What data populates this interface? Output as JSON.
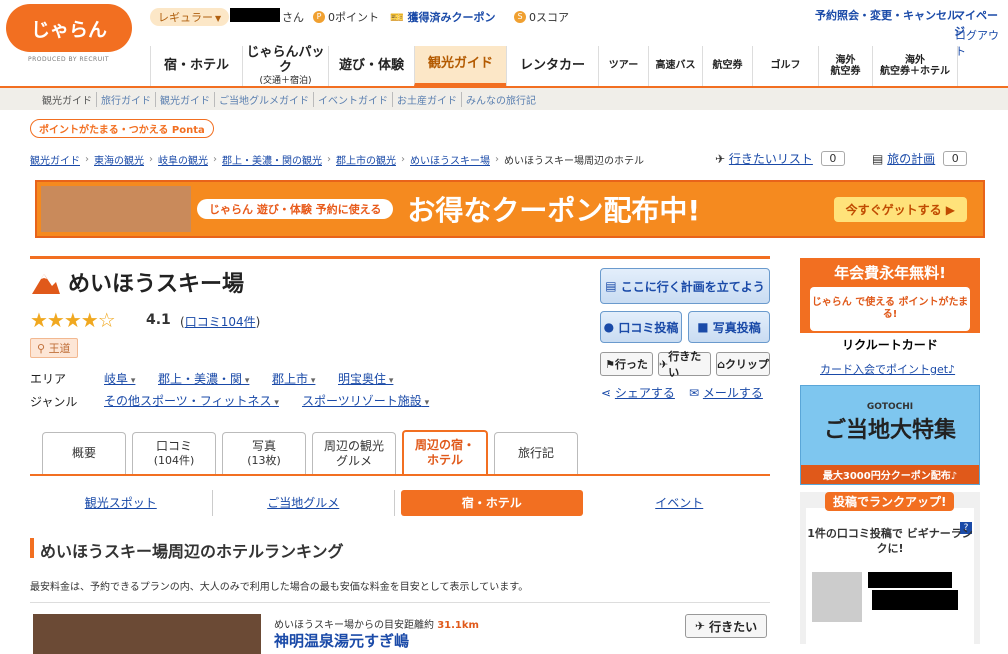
{
  "header": {
    "logo": "じゃらん",
    "produced": "PRODUCED BY RECRUIT",
    "rank": "レギュラー",
    "san": "さん",
    "points": "0ポイント",
    "coupon": "獲得済みクーポン",
    "score": "0スコア",
    "reserve": "予約照会・変更・キャンセル",
    "mypage": "マイページ",
    "logout": "ログアウト"
  },
  "nav": [
    {
      "l": "宿・ホテル"
    },
    {
      "l": "じゃらんパック",
      "s": "(交通＋宿泊)"
    },
    {
      "l": "遊び・体験"
    },
    {
      "l": "観光ガイド"
    },
    {
      "l": "レンタカー"
    },
    {
      "l": "ツアー"
    },
    {
      "l": "高速バス"
    },
    {
      "l": "航空券"
    },
    {
      "l": "ゴルフ"
    },
    {
      "l": "海外",
      "s": "航空券"
    },
    {
      "l": "海外",
      "s": "航空券＋ホテル"
    }
  ],
  "subnav": [
    "観光ガイド",
    "旅行ガイド",
    "観光ガイド",
    "ご当地グルメガイド",
    "イベントガイド",
    "お土産ガイド",
    "みんなの旅行記"
  ],
  "ponta": "ポイントがたまる・つかえる Ponta",
  "breadcrumb": [
    "観光ガイド",
    "東海の観光",
    "岐阜の観光",
    "郡上・美濃・関の観光",
    "郡上市の観光",
    "めいほうスキー場",
    "めいほうスキー場周辺のホテル"
  ],
  "wishlist": {
    "label": "行きたいリスト",
    "count": "0"
  },
  "plan": {
    "label": "旅の計画",
    "count": "0"
  },
  "banner": {
    "pill": "じゃらん 遊び・体験 予約に使える",
    "big": "お得なクーポン配布中!",
    "btn": "今すぐゲットする ▶"
  },
  "spot": {
    "title": "めいほうスキー場",
    "rating": "4.1",
    "reviews": "口コミ104件",
    "badge": "王道",
    "area_label": "エリア",
    "areas": [
      "岐阜",
      "郡上・美濃・関",
      "郡上市",
      "明宝奥住"
    ],
    "genre_label": "ジャンル",
    "genres": [
      "その他スポーツ・フィットネス",
      "スポーツリゾート施設"
    ]
  },
  "actions": {
    "plan": "ここに行く計画を立てよう",
    "review": "口コミ投稿",
    "photo": "写真投稿",
    "went": "行った",
    "want": "行きたい",
    "clip": "クリップ",
    "share": "シェアする",
    "mail": "メールする"
  },
  "tabs": [
    {
      "l": "概要"
    },
    {
      "l": "口コミ",
      "s": "(104件)"
    },
    {
      "l": "写真",
      "s": "(13枚)"
    },
    {
      "l": "周辺の観光",
      "s": "グルメ"
    },
    {
      "l": "周辺の宿・",
      "s": "ホテル"
    },
    {
      "l": "旅行記"
    }
  ],
  "subtabs": [
    "観光スポット",
    "ご当地グルメ",
    "宿・ホテル",
    "イベント"
  ],
  "ranking": {
    "title": "めいほうスキー場周辺のホテルランキング",
    "note": "最安料金は、予約できるプランの内、大人のみで利用した場合の最も安価な料金を目安として表示しています。",
    "dist_label": "めいほうスキー場からの目安距離約",
    "dist": "31.1km",
    "want": "行きたい",
    "hotel": "神明温泉湯元すぎ嶋"
  },
  "ads": {
    "card_top": "年会費永年無料!",
    "card_mid": "じゃらん で使える ポイントがたまる!",
    "card_bot": "リクルートカード",
    "card_link": "カード入会でポイントget♪",
    "gotochi": "GOTOCHI",
    "gotochi_title": "ご当地大特集",
    "gotochi_sub": "最大3000円分クーポン配布♪",
    "rank_head": "投稿でランクアップ!",
    "rank_msg": "1件の口コミ投稿で ビギナーランクに!"
  }
}
